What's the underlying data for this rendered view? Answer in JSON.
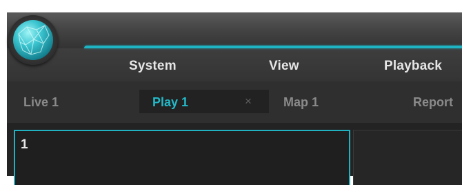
{
  "menu": {
    "items": [
      {
        "label": "System"
      },
      {
        "label": "View"
      },
      {
        "label": "Playback"
      }
    ]
  },
  "tabs": {
    "items": [
      {
        "label": "Live 1"
      },
      {
        "label": "Play 1",
        "active": true
      },
      {
        "label": "Map 1"
      },
      {
        "label": "Report"
      }
    ],
    "close_glyph": "×"
  },
  "panes": {
    "first_number": "1"
  },
  "icons": {
    "logo": "globe-logo-icon",
    "close": "close-icon"
  },
  "colors": {
    "accent": "#1fb4c4",
    "active_tab_text": "#23b9c8",
    "background": "#2b2b2b"
  }
}
